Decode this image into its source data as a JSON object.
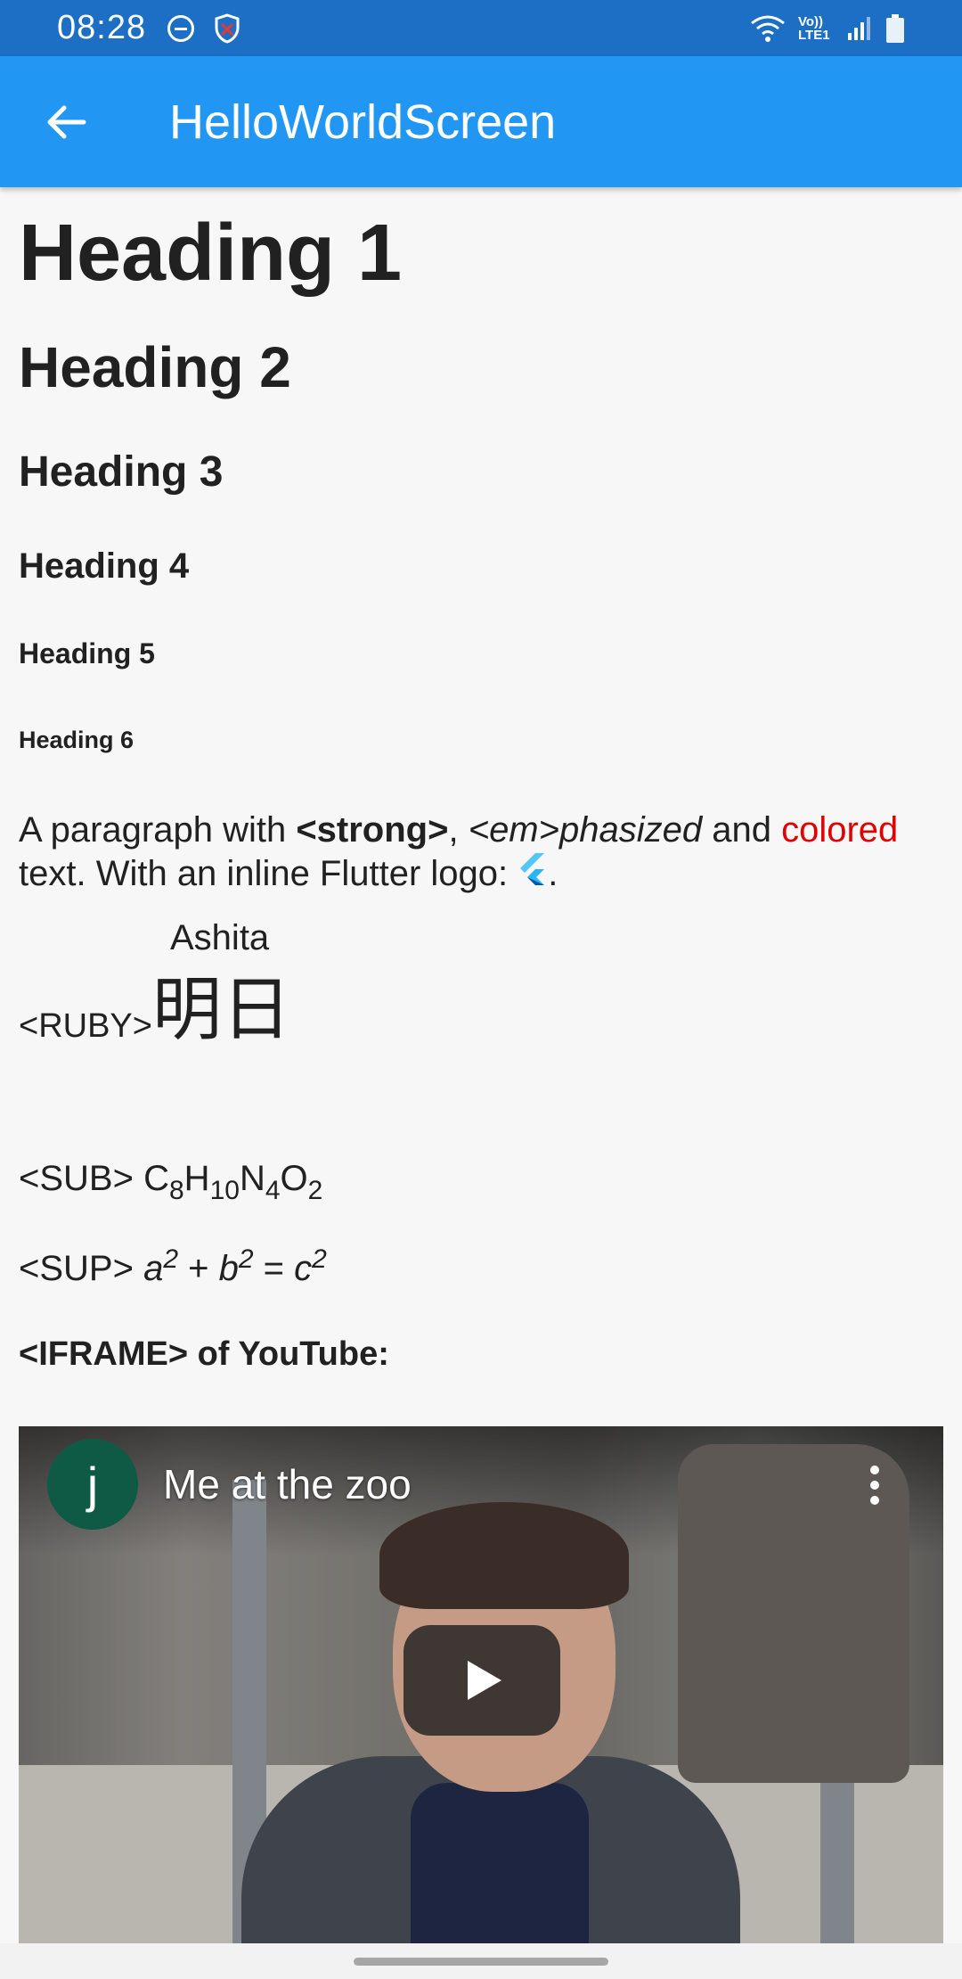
{
  "status_bar": {
    "time": "08:28",
    "left_icons": [
      "do-not-disturb-icon",
      "shield-icon"
    ],
    "right_icons": [
      "wifi-icon",
      "volte-icon",
      "signal-icon",
      "battery-icon"
    ],
    "volte_text": "Vo)) LTE1"
  },
  "app_bar": {
    "title": "HelloWorldScreen",
    "back_icon": "arrow-back-icon",
    "color": "#2196f3"
  },
  "headings": {
    "h1": "Heading 1",
    "h2": "Heading 2",
    "h3": "Heading 3",
    "h4": "Heading 4",
    "h5": "Heading 5",
    "h6": "Heading 6"
  },
  "paragraph": {
    "part1": "A paragraph with ",
    "strong": "<strong>",
    "part2": ", ",
    "em": "<em>phasized",
    "part3": " and ",
    "colored": "colored",
    "part4": " text. With an inline Flutter logo: ",
    "part5": ".",
    "colored_color": "#e00000",
    "inline_icon": "flutter-logo-icon"
  },
  "ruby": {
    "tag": "<RUBY>",
    "annotation": "Ashita",
    "base": "明日"
  },
  "sub": {
    "tag": "<SUB>",
    "formula": [
      "C",
      "8",
      "H",
      "10",
      "N",
      "4",
      "O",
      "2"
    ]
  },
  "sup": {
    "tag": "<SUP>",
    "a": "a",
    "exp_a": "2",
    "plus": " + ",
    "b": "b",
    "exp_b": "2",
    "eq": " = ",
    "c": "c",
    "exp_c": "2"
  },
  "iframe": {
    "label": "<IFRAME> of YouTube:",
    "channel_initial": "j",
    "video_title": "Me at the zoo",
    "play_icon": "play-icon",
    "more_icon": "more-vert-icon"
  }
}
